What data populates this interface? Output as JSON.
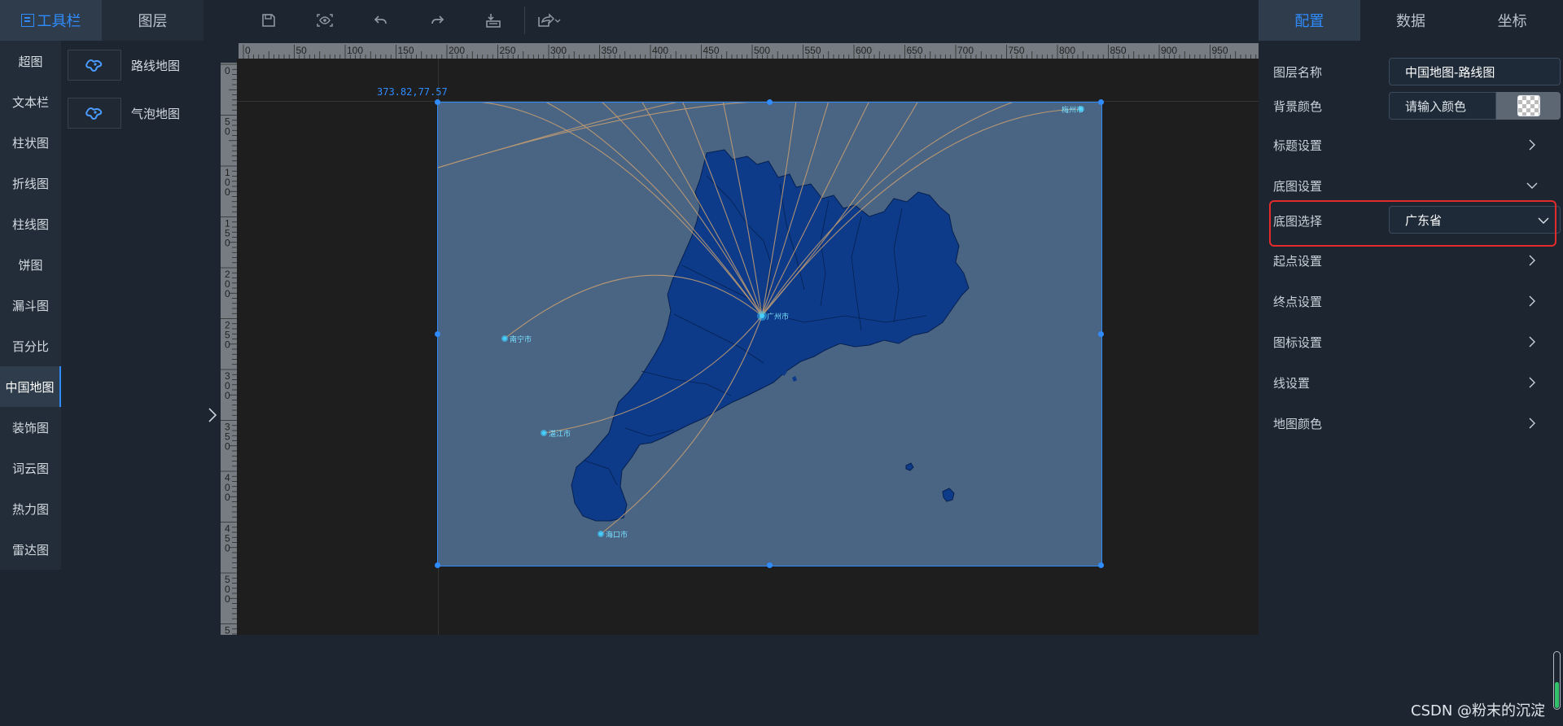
{
  "left_tabs": [
    {
      "label": "工具栏",
      "active": true,
      "icon": "toolbox-icon"
    },
    {
      "label": "图层",
      "active": false
    }
  ],
  "toolbar": {
    "buttons": [
      "save-icon",
      "preview-eye-icon",
      "undo-icon",
      "redo-icon",
      "import-icon",
      "export-icon"
    ]
  },
  "components": [
    "超图",
    "文本栏",
    "柱状图",
    "折线图",
    "柱线图",
    "饼图",
    "漏斗图",
    "百分比",
    "中国地图",
    "装饰图",
    "词云图",
    "热力图",
    "雷达图"
  ],
  "active_component": "中国地图",
  "sub_items": [
    {
      "label": "路线地图",
      "icon": "route-map-icon"
    },
    {
      "label": "气泡地图",
      "icon": "bubble-map-icon"
    }
  ],
  "ruler": {
    "top_ticks": [
      "0",
      "50",
      "100",
      "150",
      "200",
      "250",
      "300",
      "350",
      "400",
      "450",
      "500",
      "550",
      "600",
      "650",
      "700",
      "750",
      "800",
      "850",
      "900",
      "950"
    ],
    "left_ticks": [
      "0",
      "50",
      "100",
      "150",
      "200",
      "250",
      "300",
      "350",
      "400",
      "450",
      "500",
      "55"
    ]
  },
  "canvas": {
    "coord_label": "373.82,77.57",
    "map_cities": [
      "广州市",
      "湛江市",
      "海口市",
      "南宁市",
      "梅州市"
    ],
    "colors": {
      "map_fill": "#0d3b8a",
      "bg": "#4a6484",
      "lines": "#c9a071",
      "canvas": "#1e1e1e"
    }
  },
  "right_tabs": [
    {
      "label": "配置",
      "active": true
    },
    {
      "label": "数据",
      "active": false
    },
    {
      "label": "坐标",
      "active": false
    }
  ],
  "config": {
    "layer_name_label": "图层名称",
    "layer_name_value": "中国地图-路线图",
    "bg_color_label": "背景颜色",
    "bg_color_placeholder": "请输入颜色",
    "title_settings": "标题设置",
    "basemap_settings": "底图设置",
    "basemap_select_label": "底图选择",
    "basemap_select_value": "广东省",
    "start_settings": "起点设置",
    "end_settings": "终点设置",
    "icon_settings": "图标设置",
    "line_settings": "线设置",
    "map_color": "地图颜色"
  },
  "watermark": "CSDN @粉末的沉淀"
}
